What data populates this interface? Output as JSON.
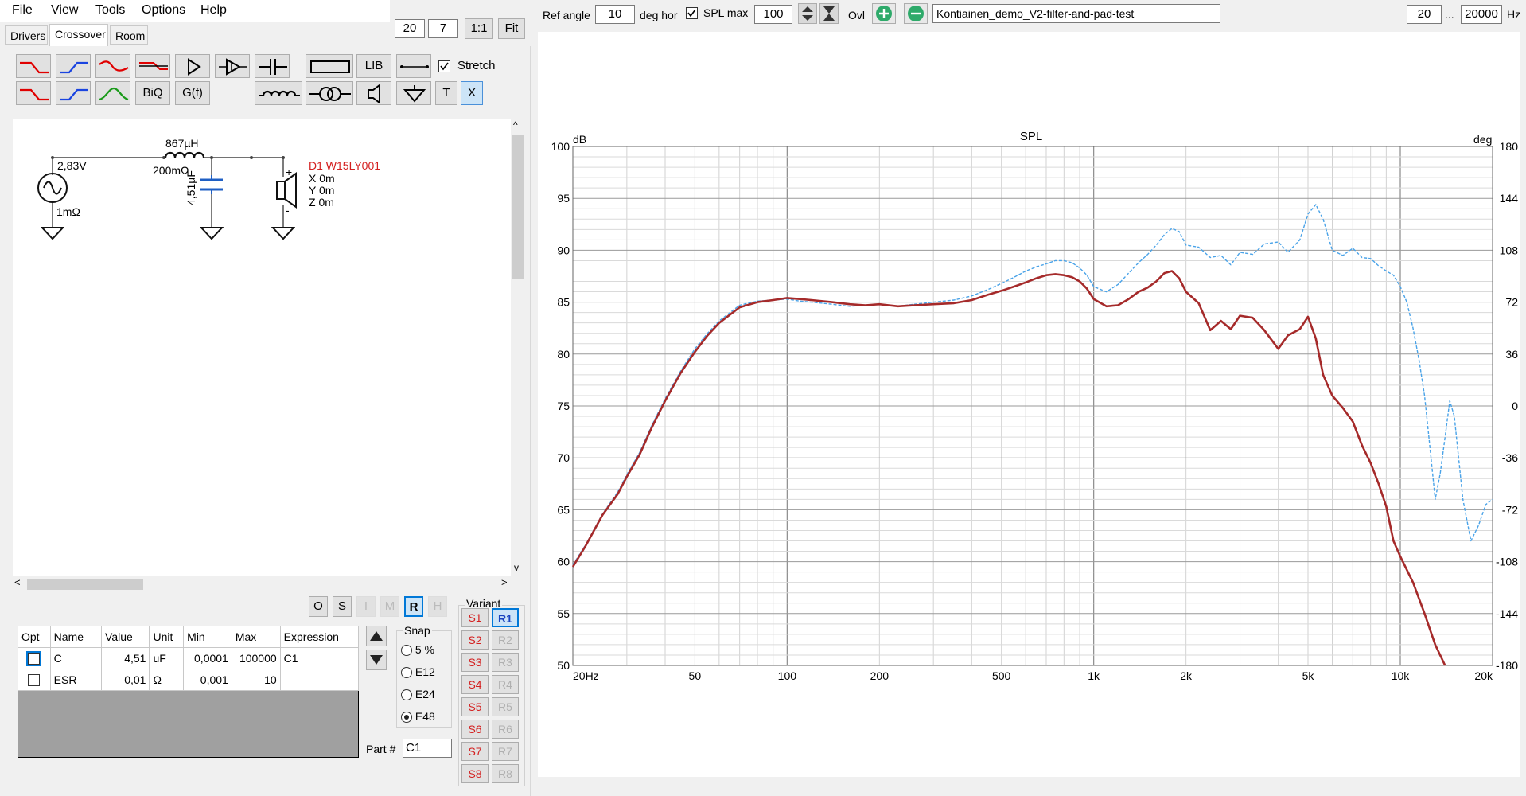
{
  "menu": [
    "File",
    "View",
    "Tools",
    "Options",
    "Help"
  ],
  "tabs": [
    "Drivers",
    "Crossover",
    "Room"
  ],
  "zoom": {
    "a": "20",
    "b": "7",
    "ratio": "1:1",
    "fit": "Fit"
  },
  "top": {
    "ref_angle_label": "Ref angle",
    "ref_angle": "10",
    "deg_hor": "deg hor",
    "spl_max_label": "SPL max",
    "spl_max": "100",
    "ovl": "Ovl",
    "filename": "Kontiainen_demo_V2-filter-and-pad-test",
    "f_from": "20",
    "ellipsis": "...",
    "f_to": "20000",
    "hz": "Hz"
  },
  "toolbar": {
    "lib": "LIB",
    "stretch": "Stretch",
    "biq": "BiQ",
    "gf": "G(f)",
    "t": "T",
    "x": "X"
  },
  "schematic": {
    "source_v": "2,83V",
    "source_r": "1mΩ",
    "inductor_l": "867µH",
    "inductor_r": "200mΩ",
    "cap": "4,51µF",
    "driver_name": "D1 W15LY001",
    "x": "X 0m",
    "y": "Y 0m",
    "z": "Z 0m",
    "plus": "+",
    "minus": "-"
  },
  "view_buttons": [
    "O",
    "S",
    "I",
    "M",
    "R",
    "H"
  ],
  "table": {
    "headers": [
      "Opt",
      "Name",
      "Value",
      "Unit",
      "Min",
      "Max",
      "Expression"
    ],
    "rows": [
      {
        "name": "C",
        "value": "4,51",
        "unit": "uF",
        "min": "0,0001",
        "max": "100000",
        "expr": "C1"
      },
      {
        "name": "ESR",
        "value": "0,01",
        "unit": "Ω",
        "min": "0,001",
        "max": "10",
        "expr": ""
      }
    ]
  },
  "snap": {
    "title": "Snap",
    "options": [
      "5 %",
      "E12",
      "E24",
      "E48"
    ],
    "selected": "E48"
  },
  "part": {
    "label": "Part #",
    "value": "C1"
  },
  "variant": {
    "title": "Variant",
    "s": [
      "S1",
      "S2",
      "S3",
      "S4",
      "S5",
      "S6",
      "S7",
      "S8"
    ],
    "r": [
      "R1",
      "R2",
      "R3",
      "R4",
      "R5",
      "R6",
      "R7",
      "R8"
    ]
  },
  "colors": {
    "red_series": "#a52a2a",
    "blue_series": "#4aa3e8",
    "accent": "#0078d7"
  },
  "chart_data": {
    "type": "line",
    "title": "SPL",
    "ylabel": "dB",
    "y2label": "deg",
    "xscale": "log",
    "xlim": [
      20,
      20000
    ],
    "ylim": [
      50,
      100
    ],
    "y2lim": [
      -180,
      180
    ],
    "x_ticks": [
      {
        "v": 20,
        "t": "20Hz"
      },
      {
        "v": 50,
        "t": "50"
      },
      {
        "v": 100,
        "t": "100"
      },
      {
        "v": 200,
        "t": "200"
      },
      {
        "v": 500,
        "t": "500"
      },
      {
        "v": 1000,
        "t": "1k"
      },
      {
        "v": 2000,
        "t": "2k"
      },
      {
        "v": 5000,
        "t": "5k"
      },
      {
        "v": 10000,
        "t": "10k"
      },
      {
        "v": 20000,
        "t": "20k"
      }
    ],
    "y_ticks": [
      100,
      95,
      90,
      85,
      80,
      75,
      70,
      65,
      60,
      55,
      50
    ],
    "y2_ticks": [
      180,
      144,
      108,
      72,
      36,
      0,
      -36,
      -72,
      -108,
      -144,
      -180
    ],
    "series": [
      {
        "color": "#a52a2a",
        "x": [
          20,
          22,
          25,
          28,
          30,
          33,
          36,
          40,
          45,
          50,
          55,
          60,
          70,
          80,
          90,
          100,
          110,
          120,
          140,
          160,
          180,
          200,
          230,
          260,
          300,
          350,
          400,
          450,
          500,
          550,
          600,
          650,
          700,
          750,
          800,
          850,
          900,
          950,
          1000,
          1100,
          1200,
          1300,
          1400,
          1500,
          1600,
          1700,
          1800,
          1900,
          2000,
          2200,
          2400,
          2600,
          2800,
          3000,
          3300,
          3600,
          4000,
          4300,
          4700,
          5000,
          5300,
          5600,
          6000,
          6500,
          7000,
          7500,
          8000,
          8500,
          9000,
          9500,
          10000,
          11000,
          12000,
          13000,
          14000
        ],
        "y": [
          59.5,
          61.5,
          64.5,
          66.5,
          68.2,
          70.3,
          72.8,
          75.5,
          78.2,
          80.2,
          81.8,
          83.0,
          84.5,
          85.0,
          85.2,
          85.4,
          85.3,
          85.2,
          85.0,
          84.8,
          84.7,
          84.8,
          84.6,
          84.7,
          84.8,
          84.9,
          85.2,
          85.7,
          86.1,
          86.5,
          86.9,
          87.3,
          87.6,
          87.7,
          87.6,
          87.4,
          87.0,
          86.3,
          85.3,
          84.6,
          84.7,
          85.3,
          86.0,
          86.4,
          87.0,
          87.8,
          88.0,
          87.3,
          86.0,
          84.9,
          82.3,
          83.2,
          82.4,
          83.7,
          83.5,
          82.3,
          80.5,
          81.8,
          82.4,
          83.6,
          81.5,
          78.0,
          76.0,
          74.8,
          73.5,
          71.2,
          69.5,
          67.5,
          65.3,
          62.0,
          60.5,
          58.0,
          55.0,
          52.0,
          50.0
        ]
      },
      {
        "color": "#4aa3e8",
        "x": [
          20,
          22,
          25,
          28,
          30,
          33,
          36,
          40,
          45,
          50,
          55,
          60,
          70,
          80,
          90,
          100,
          110,
          120,
          140,
          160,
          180,
          200,
          230,
          260,
          300,
          350,
          400,
          450,
          500,
          550,
          600,
          650,
          700,
          750,
          800,
          850,
          900,
          950,
          1000,
          1100,
          1200,
          1300,
          1400,
          1500,
          1600,
          1700,
          1800,
          1900,
          2000,
          2200,
          2400,
          2600,
          2800,
          3000,
          3300,
          3600,
          4000,
          4300,
          4700,
          5000,
          5300,
          5600,
          6000,
          6500,
          7000,
          7500,
          8000,
          8500,
          9000,
          9500,
          10000,
          10500,
          11000,
          11500,
          12000,
          12500,
          13000,
          13500,
          14000,
          14500,
          15000,
          16000,
          17000,
          18000,
          19000,
          20000
        ],
        "y": [
          59.7,
          61.6,
          64.6,
          66.7,
          68.4,
          70.5,
          73.0,
          75.7,
          78.4,
          80.5,
          82.0,
          83.2,
          84.7,
          85.1,
          85.2,
          85.3,
          85.1,
          85.0,
          84.8,
          84.6,
          84.7,
          84.8,
          84.6,
          84.8,
          85.0,
          85.2,
          85.6,
          86.2,
          86.8,
          87.4,
          88.0,
          88.4,
          88.7,
          89.0,
          89.0,
          88.8,
          88.3,
          87.6,
          86.5,
          86.0,
          86.7,
          87.8,
          88.8,
          89.6,
          90.5,
          91.5,
          92.1,
          91.8,
          90.5,
          90.3,
          89.3,
          89.5,
          88.6,
          89.8,
          89.6,
          90.6,
          90.8,
          89.8,
          91.0,
          93.5,
          94.4,
          93.0,
          90.0,
          89.5,
          90.2,
          89.3,
          89.2,
          88.5,
          88.0,
          87.6,
          86.5,
          85.0,
          82.5,
          79.5,
          76.0,
          71.0,
          66.0,
          68.5,
          72.0,
          75.5,
          74.0,
          66.0,
          62.0,
          63.5,
          65.5,
          66.0
        ]
      }
    ]
  }
}
